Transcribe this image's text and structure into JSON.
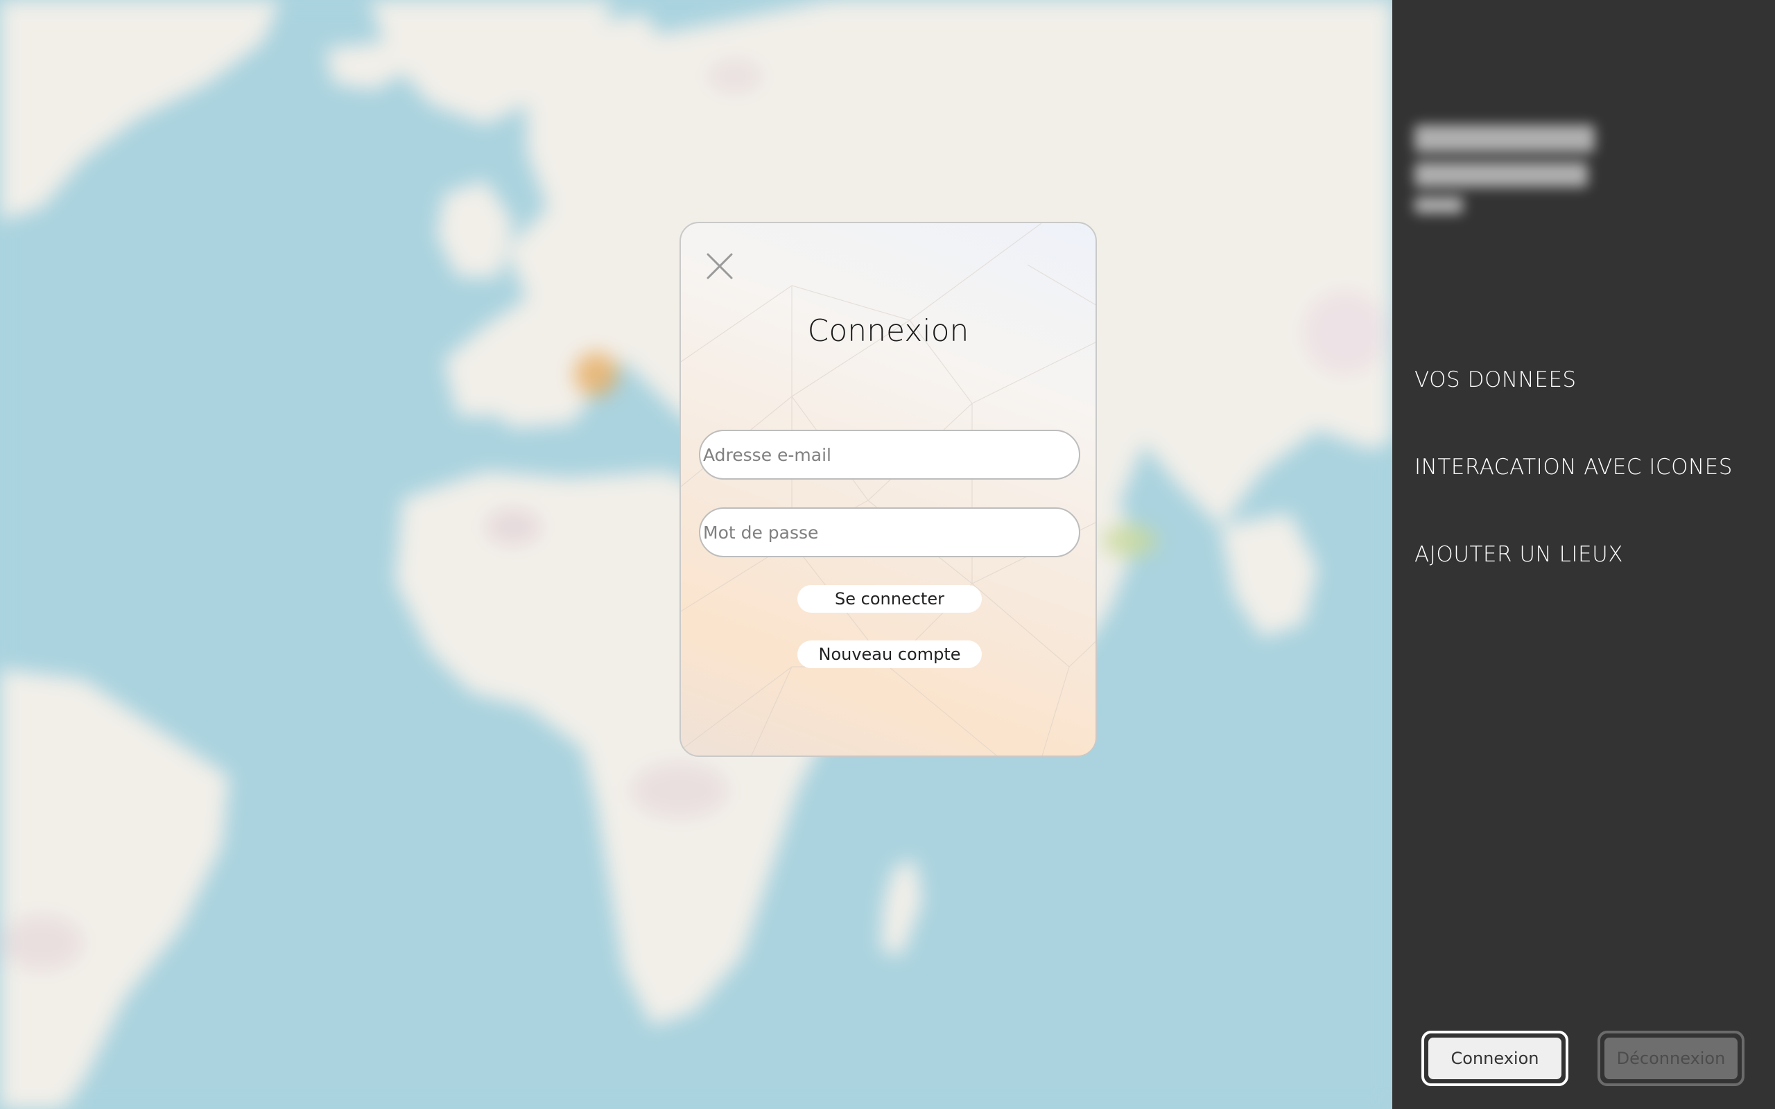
{
  "modal": {
    "title": "Connexion",
    "email_placeholder": "Adresse e-mail",
    "password_placeholder": "Mot de passe",
    "submit_label": "Se connecter",
    "new_account_label": "Nouveau compte",
    "close_icon": "close-icon"
  },
  "sidebar": {
    "menu": [
      {
        "label": "VOS DONNEES"
      },
      {
        "label": "INTERACATION AVEC ICONES"
      },
      {
        "label": "AJOUTER UN LIEUX"
      }
    ],
    "login_label": "Connexion",
    "logout_label": "Déconnexion"
  },
  "colors": {
    "sidebar_bg": "#333333",
    "map_water": "#aad3df",
    "map_land": "#f2efe9",
    "text_light": "#ffffff"
  }
}
